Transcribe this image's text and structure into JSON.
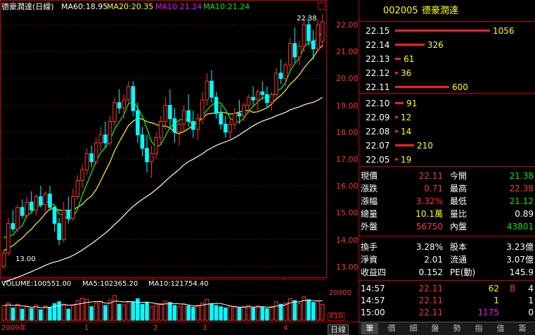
{
  "header": {
    "title": "德豪潤達(日線)",
    "ma60": "MA60:18.95",
    "ma20": "MA20:20.35",
    "ma10a": "MA10:21.24",
    "ma10b": "MA10:21.24",
    "colors": {
      "ma60": "#ffffff",
      "ma20": "#ffff00",
      "ma10": "#ff00ff",
      "ma10b": "#00ff00"
    }
  },
  "price_axis": [
    "22.00",
    "21.00",
    "20.00",
    "19.00",
    "18.00",
    "17.00",
    "16.00",
    "15.00",
    "14.00",
    "13.00"
  ],
  "annotations": {
    "high": "22.38",
    "low": "13.00"
  },
  "volume": {
    "header": "VOLUME:100551.00",
    "ma5": "MA5:102365.20",
    "ma10": "MA10:121754.40",
    "axis_label": "20000",
    "unit": "X10"
  },
  "date_axis": [
    "2009年",
    "1",
    "2",
    "3",
    "4"
  ],
  "bottom_label": "日線",
  "quote": {
    "code": "002005",
    "name": "德豪潤達",
    "asks": [
      {
        "price": "22.15",
        "vol": "1056",
        "bar": 1.0
      },
      {
        "price": "22.14",
        "vol": "326",
        "bar": 0.31
      },
      {
        "price": "22.13",
        "vol": "61",
        "bar": 0.06
      },
      {
        "price": "22.12",
        "vol": "36",
        "bar": 0.03
      },
      {
        "price": "22.11",
        "vol": "600",
        "bar": 0.57
      }
    ],
    "bids": [
      {
        "price": "22.10",
        "vol": "91",
        "bar": 0.09
      },
      {
        "price": "22.09",
        "vol": "12",
        "bar": 0.01
      },
      {
        "price": "22.08",
        "vol": "14",
        "bar": 0.01
      },
      {
        "price": "22.07",
        "vol": "210",
        "bar": 0.2
      },
      {
        "price": "22.05",
        "vol": "19",
        "bar": 0.02
      }
    ],
    "stats": [
      {
        "l1": "現價",
        "v1": "22.11",
        "c1": "red",
        "l2": "今開",
        "v2": "21.38",
        "c2": "grn"
      },
      {
        "l1": "漲跌",
        "v1": "0.71",
        "c1": "red",
        "l2": "最高",
        "v2": "22.38",
        "c2": "red"
      },
      {
        "l1": "漲幅",
        "v1": "3.32%",
        "c1": "red",
        "l2": "最低",
        "v2": "21.12",
        "c2": "grn"
      },
      {
        "l1": "總量",
        "v1": "10.1萬",
        "c1": "ylw",
        "l2": "量比",
        "v2": "0.89",
        "c2": "wht"
      },
      {
        "l1": "外盤",
        "v1": "56750",
        "c1": "red",
        "l2": "內盤",
        "v2": "43801",
        "c2": "grn"
      }
    ],
    "stats2": [
      {
        "l1": "換手",
        "v1": "3.28%",
        "l2": "股本",
        "v2": "3.23億"
      },
      {
        "l1": "淨資",
        "v1": "2.01",
        "l2": "流通",
        "v2": "3.07億"
      },
      {
        "l1": "收益四",
        "v1": "0.152",
        "l2": "PE(動)",
        "v2": "145.9"
      }
    ],
    "ticks": [
      {
        "time": "14:57",
        "price": "22.11",
        "vol": "62",
        "side": "B",
        "n": "4"
      },
      {
        "time": "14:57",
        "price": "22.11",
        "vol": "1",
        "side": "",
        "n": "1"
      },
      {
        "time": "15:00",
        "price": "22.11",
        "vol": "1175",
        "side": "",
        "n": "0"
      }
    ]
  },
  "tabs": [
    "筆",
    "價",
    "細",
    "盤",
    "勢",
    "指",
    "值",
    "籌"
  ],
  "chart_data": {
    "type": "candlestick",
    "title": "德豪潤達(日線)",
    "ylim": [
      12.6,
      22.5
    ],
    "ohlc": [
      [
        13.0,
        13.6,
        12.9,
        13.5
      ],
      [
        13.5,
        14.8,
        13.4,
        14.6
      ],
      [
        14.6,
        15.1,
        14.3,
        14.4
      ],
      [
        14.4,
        15.3,
        14.3,
        15.2
      ],
      [
        15.2,
        15.5,
        14.8,
        14.9
      ],
      [
        14.9,
        15.6,
        14.8,
        15.4
      ],
      [
        15.4,
        15.8,
        15.0,
        15.1
      ],
      [
        15.1,
        15.7,
        14.9,
        15.6
      ],
      [
        15.6,
        16.0,
        15.2,
        15.3
      ],
      [
        15.3,
        15.8,
        15.0,
        15.7
      ],
      [
        15.7,
        16.0,
        15.1,
        15.2
      ],
      [
        15.2,
        15.3,
        14.3,
        14.6
      ],
      [
        14.6,
        14.8,
        13.8,
        14.0
      ],
      [
        14.0,
        15.4,
        13.9,
        15.1
      ],
      [
        15.1,
        15.6,
        14.6,
        14.8
      ],
      [
        14.8,
        15.9,
        14.7,
        15.6
      ],
      [
        15.6,
        16.4,
        15.5,
        16.2
      ],
      [
        16.2,
        16.8,
        15.9,
        16.6
      ],
      [
        16.6,
        17.4,
        16.4,
        17.2
      ],
      [
        17.2,
        17.5,
        16.7,
        16.9
      ],
      [
        16.9,
        17.8,
        16.8,
        17.6
      ],
      [
        17.6,
        18.2,
        17.3,
        17.9
      ],
      [
        17.9,
        18.4,
        17.4,
        17.6
      ],
      [
        17.6,
        18.6,
        17.5,
        18.4
      ],
      [
        18.4,
        19.3,
        18.2,
        19.1
      ],
      [
        19.1,
        19.6,
        18.7,
        18.9
      ],
      [
        18.9,
        19.4,
        18.5,
        19.2
      ],
      [
        19.2,
        19.9,
        19.0,
        19.7
      ],
      [
        19.7,
        19.9,
        18.6,
        18.8
      ],
      [
        18.8,
        19.1,
        17.6,
        17.9
      ],
      [
        17.9,
        18.2,
        17.1,
        17.4
      ],
      [
        17.4,
        17.9,
        16.5,
        16.9
      ],
      [
        16.9,
        17.5,
        16.3,
        17.2
      ],
      [
        17.2,
        18.0,
        17.0,
        17.8
      ],
      [
        17.8,
        18.6,
        17.5,
        18.4
      ],
      [
        18.4,
        19.3,
        18.1,
        19.0
      ],
      [
        19.0,
        19.6,
        18.2,
        18.5
      ],
      [
        18.5,
        18.9,
        17.6,
        18.0
      ],
      [
        18.0,
        18.5,
        17.5,
        18.3
      ],
      [
        18.3,
        19.0,
        18.0,
        18.8
      ],
      [
        18.8,
        19.4,
        18.2,
        18.4
      ],
      [
        18.4,
        18.8,
        17.8,
        18.1
      ],
      [
        18.1,
        18.7,
        17.7,
        18.5
      ],
      [
        18.5,
        19.5,
        18.3,
        19.2
      ],
      [
        19.2,
        20.2,
        19.0,
        19.9
      ],
      [
        19.9,
        20.3,
        19.1,
        19.3
      ],
      [
        19.3,
        19.5,
        18.5,
        18.7
      ],
      [
        18.7,
        19.0,
        18.1,
        18.3
      ],
      [
        18.3,
        18.6,
        17.8,
        18.0
      ],
      [
        18.0,
        18.5,
        17.7,
        18.3
      ],
      [
        18.3,
        18.9,
        18.1,
        18.7
      ],
      [
        18.7,
        19.2,
        18.3,
        18.6
      ],
      [
        18.6,
        19.1,
        18.4,
        19.0
      ],
      [
        19.0,
        19.4,
        18.7,
        19.3
      ],
      [
        19.3,
        19.7,
        19.0,
        19.2
      ],
      [
        19.2,
        19.6,
        18.8,
        19.5
      ],
      [
        19.5,
        19.9,
        19.2,
        19.4
      ],
      [
        19.4,
        19.7,
        18.9,
        19.1
      ],
      [
        19.1,
        19.5,
        18.8,
        19.4
      ],
      [
        19.4,
        20.4,
        19.3,
        20.2
      ],
      [
        20.2,
        20.7,
        19.8,
        20.0
      ],
      [
        20.0,
        20.6,
        19.7,
        20.5
      ],
      [
        20.5,
        21.5,
        20.3,
        21.3
      ],
      [
        21.3,
        21.9,
        20.6,
        20.8
      ],
      [
        20.8,
        21.4,
        20.5,
        21.2
      ],
      [
        21.2,
        22.2,
        21.0,
        22.0
      ],
      [
        22.0,
        22.3,
        21.2,
        21.4
      ],
      [
        21.4,
        21.8,
        20.7,
        21.1
      ],
      [
        21.1,
        22.2,
        21.0,
        22.0
      ],
      [
        21.38,
        22.38,
        21.12,
        22.11
      ]
    ],
    "volume": [
      24,
      28,
      20,
      26,
      18,
      22,
      19,
      25,
      17,
      23,
      21,
      27,
      30,
      26,
      18,
      24,
      32,
      36,
      34,
      22,
      28,
      31,
      24,
      33,
      40,
      26,
      25,
      29,
      30,
      35,
      26,
      28,
      22,
      25,
      27,
      31,
      29,
      24,
      22,
      26,
      23,
      21,
      24,
      28,
      34,
      27,
      24,
      22,
      20,
      23,
      21,
      20,
      22,
      24,
      20,
      23,
      21,
      19,
      22,
      30,
      26,
      28,
      35,
      32,
      27,
      38,
      33,
      29,
      31,
      26
    ]
  }
}
